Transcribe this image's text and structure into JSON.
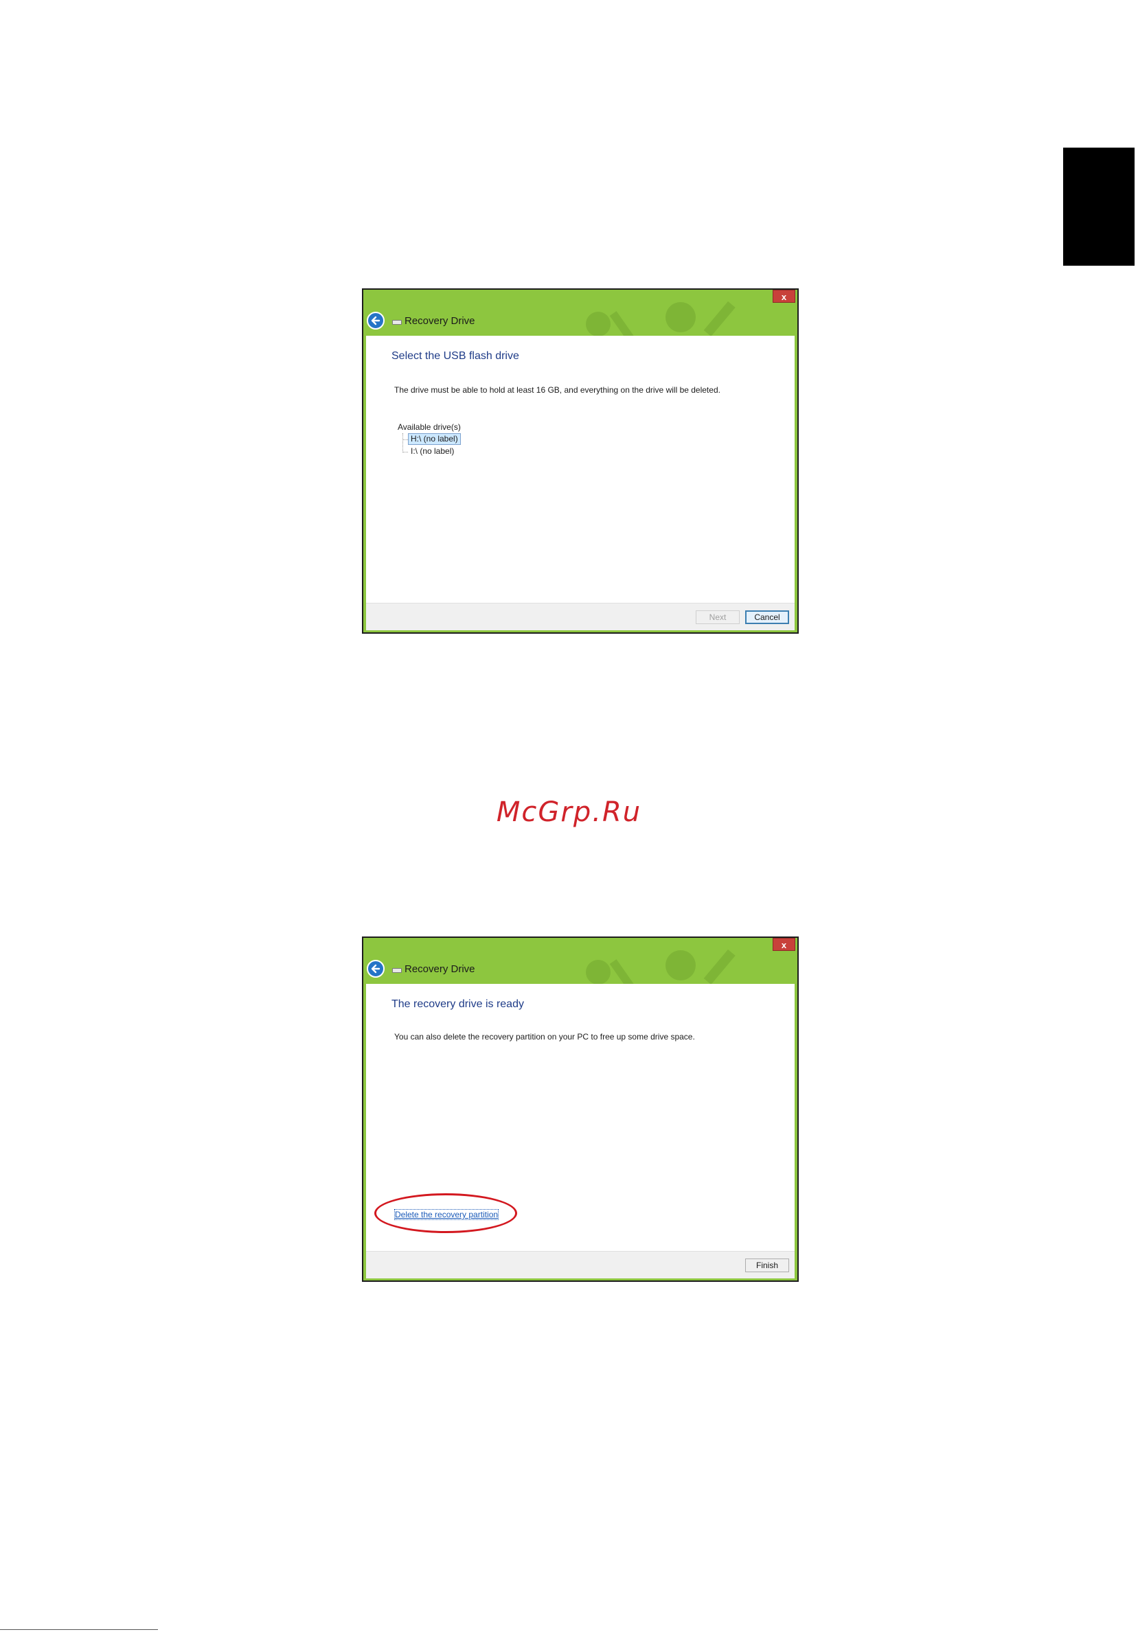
{
  "watermark": "McGrp.Ru",
  "dialogs": [
    {
      "window_title": "Recovery Drive",
      "close_glyph": "x",
      "heading": "Select the USB flash drive",
      "description": "The drive must be able to hold at least 16 GB, and everything on the drive will be deleted.",
      "drives_label": "Available drive(s)",
      "drives": [
        {
          "label": "H:\\ (no label)",
          "selected": true
        },
        {
          "label": "I:\\ (no label)",
          "selected": false
        }
      ],
      "buttons": {
        "next": "Next",
        "cancel": "Cancel"
      }
    },
    {
      "window_title": "Recovery Drive",
      "close_glyph": "x",
      "heading": "The recovery drive is ready",
      "description": "You can also delete the recovery partition on your PC to free up some drive space.",
      "link": "Delete the recovery partition",
      "buttons": {
        "finish": "Finish"
      }
    }
  ],
  "colors": {
    "title_bar": "#8dc63f",
    "heading": "#1f3c88",
    "highlight": "#d3181f",
    "watermark": "#d0232a"
  },
  "icons": [
    "back-arrow-icon",
    "drive-icon",
    "close-icon"
  ]
}
